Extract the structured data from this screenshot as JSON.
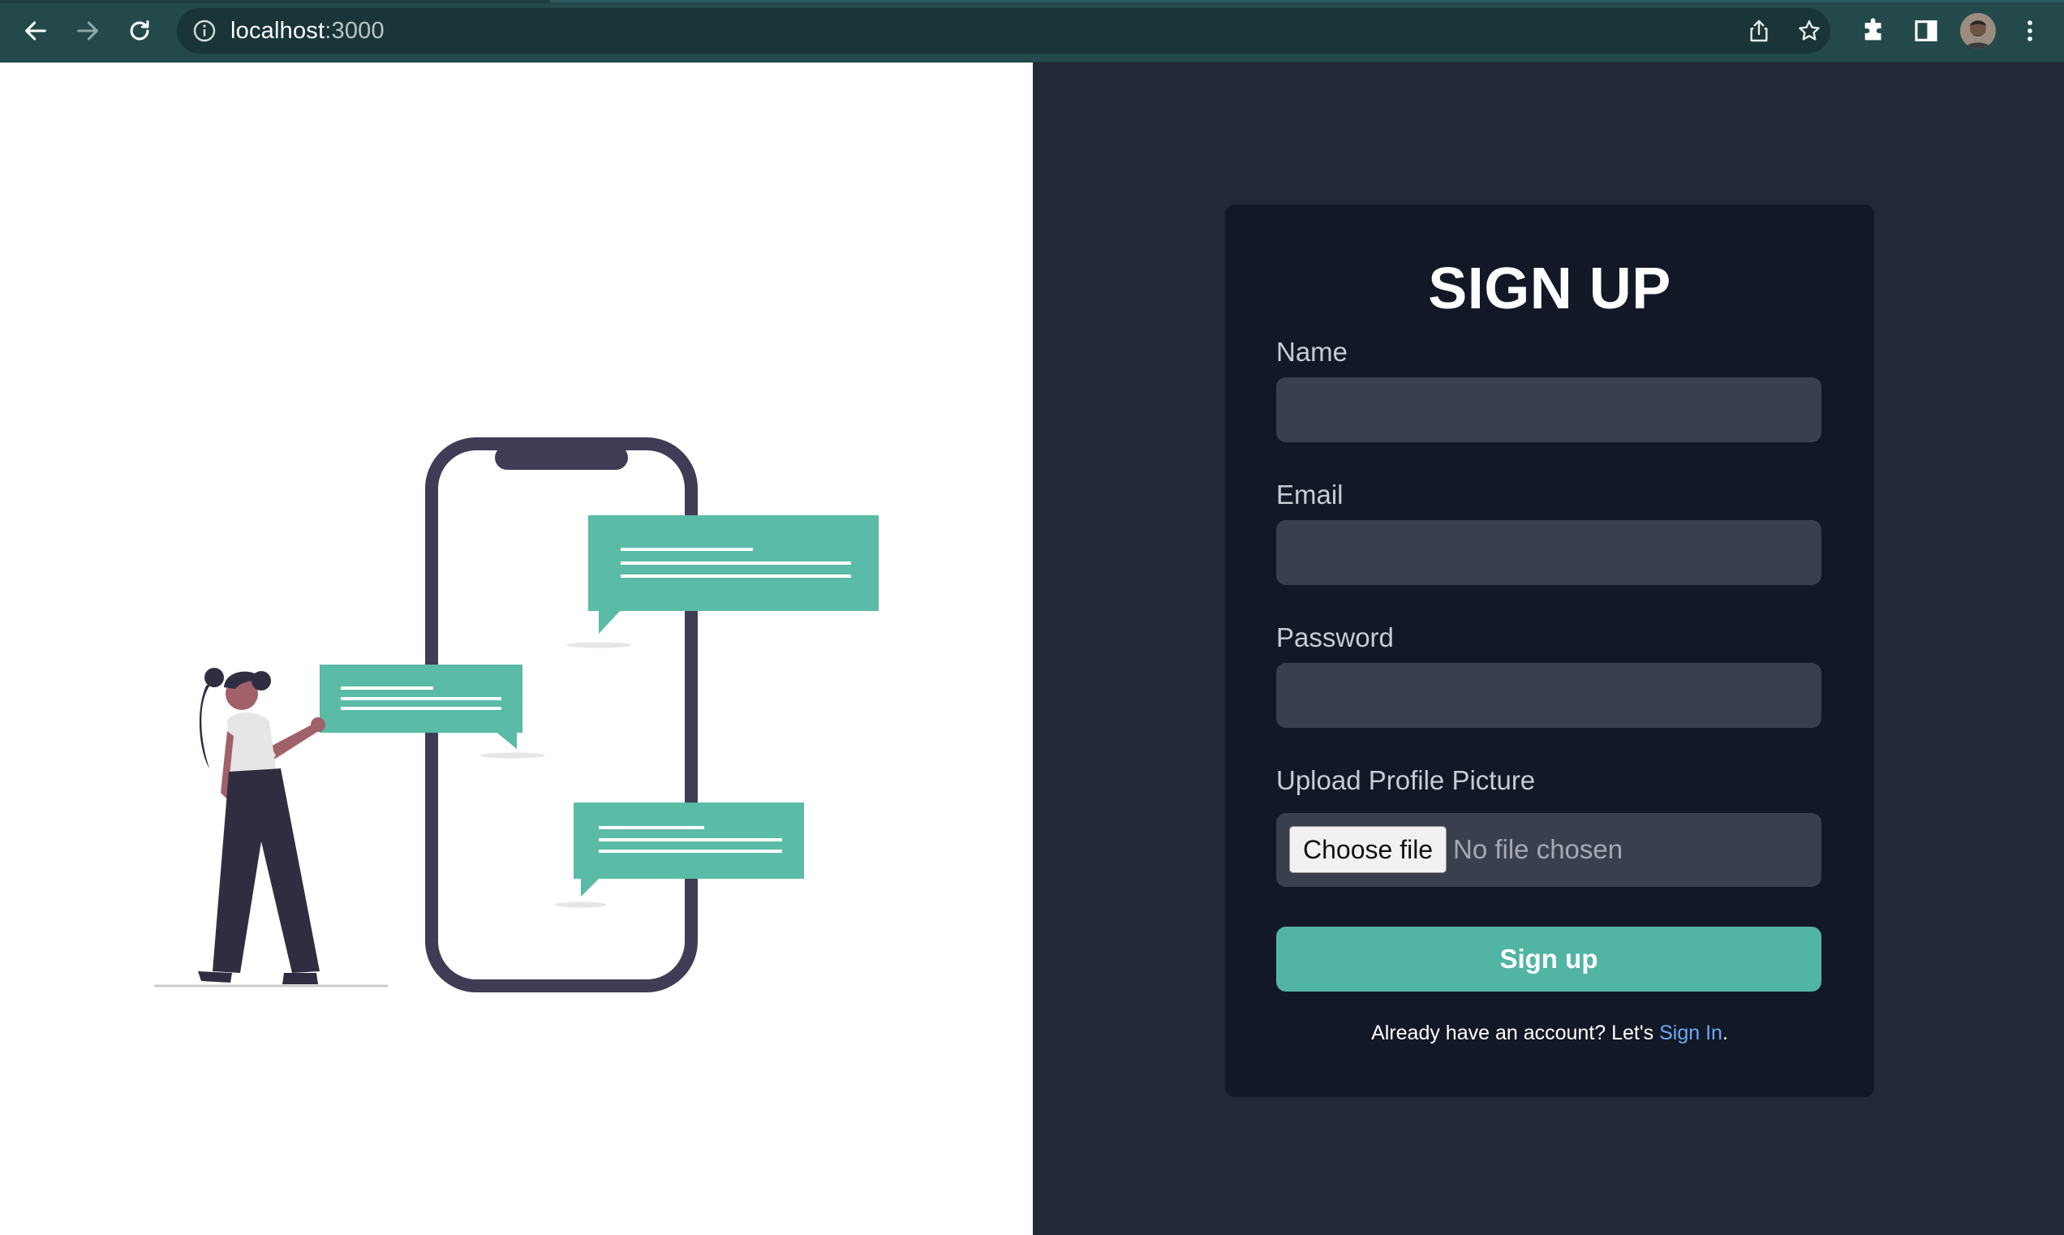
{
  "browser": {
    "url_host": "localhost",
    "url_port": ":3000",
    "icons": {
      "back": "arrow-left-icon",
      "forward": "arrow-right-icon",
      "reload": "reload-icon",
      "site_info": "info-icon",
      "share": "share-icon",
      "bookmark": "star-icon",
      "extensions": "puzzle-icon",
      "side_panel": "side-panel-icon",
      "menu": "kebab-menu-icon"
    }
  },
  "colors": {
    "chrome_bg": "#23494b",
    "right_bg": "#222836",
    "card_bg": "#121826",
    "input_bg": "#3a3f4e",
    "accent": "#52b4a3",
    "link": "#6ea8f7",
    "illustration_dark": "#3f3d56",
    "illustration_green": "#5abba6"
  },
  "form": {
    "title": "SIGN UP",
    "name_label": "Name",
    "name_value": "",
    "email_label": "Email",
    "email_value": "",
    "password_label": "Password",
    "password_value": "",
    "upload_label": "Upload Profile Picture",
    "choose_file_label": "Choose file",
    "no_file_text": "No file chosen",
    "submit_label": "Sign up",
    "footer_prefix": "Already have an account? Let's ",
    "footer_link": "Sign In",
    "footer_suffix": "."
  }
}
